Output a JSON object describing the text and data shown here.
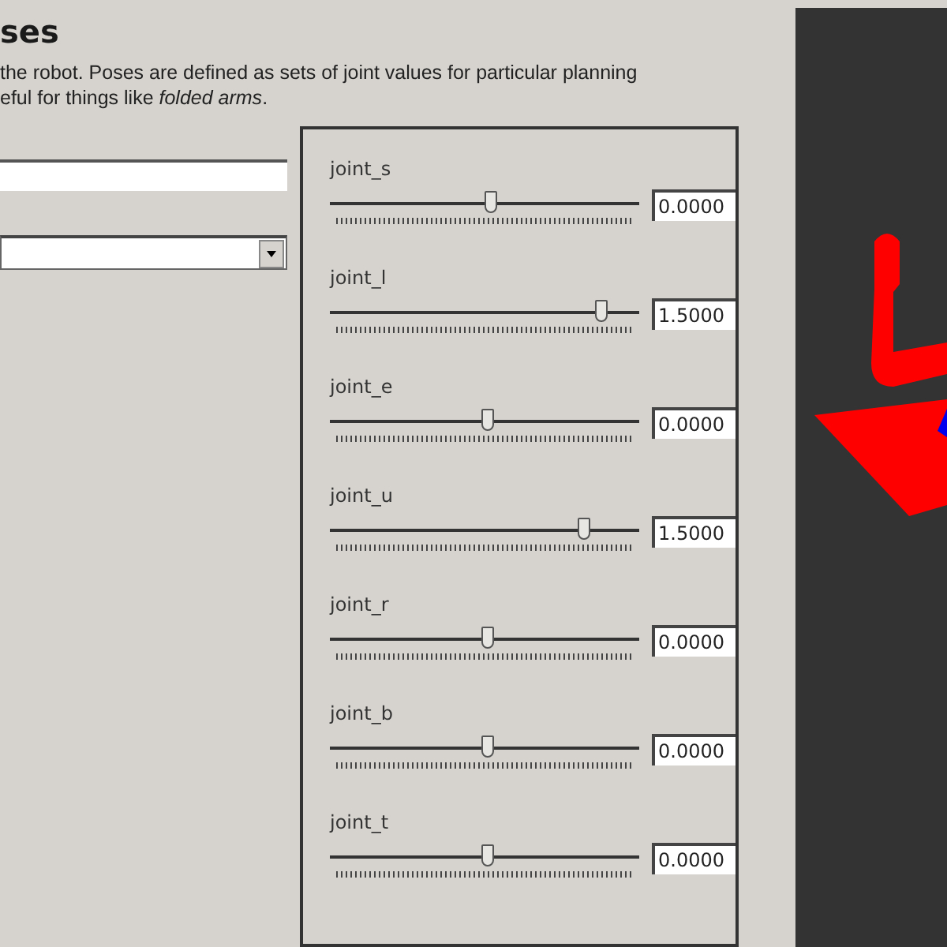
{
  "header": {
    "title": "ses",
    "description": [
      "the robot. Poses are defined as sets of joint values for particular planning",
      "eful for things like *folded arms*."
    ]
  },
  "joints": [
    {
      "name": "joint_s",
      "level": 0.52,
      "value": "0.0000"
    },
    {
      "name": "joint_l",
      "level": 0.88,
      "value": "1.5000"
    },
    {
      "name": "joint_e",
      "level": 0.51,
      "value": "0.0000"
    },
    {
      "name": "joint_u",
      "level": 0.82,
      "value": "1.5000"
    },
    {
      "name": "joint_r",
      "level": 0.51,
      "value": "0.0000"
    },
    {
      "name": "joint_b",
      "level": 0.51,
      "value": "0.0000"
    },
    {
      "name": "joint_t",
      "level": 0.51,
      "value": "0.0000"
    }
  ]
}
